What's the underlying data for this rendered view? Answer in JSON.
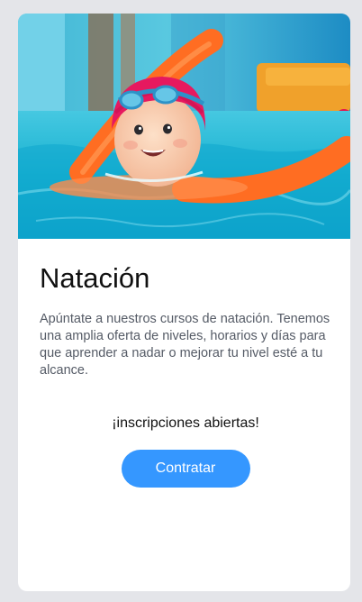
{
  "card": {
    "image": {
      "icon": "swimming-child-photo"
    },
    "title": "Natación",
    "description": "Apúntate a nuestros cursos de natación. Tenemos una amplia oferta de niveles, horarios y días para que aprender a nadar o mejorar tu nivel esté a tu alcance.",
    "status": "¡inscripciones abiertas!",
    "button_label": "Contratar",
    "colors": {
      "background": "#e4e5e9",
      "card": "#ffffff",
      "accent": "#3597ff",
      "pool_water": "#1fb7d9",
      "swim_cap": "#e6195f",
      "pool_noodle": "#ff6d22"
    }
  }
}
